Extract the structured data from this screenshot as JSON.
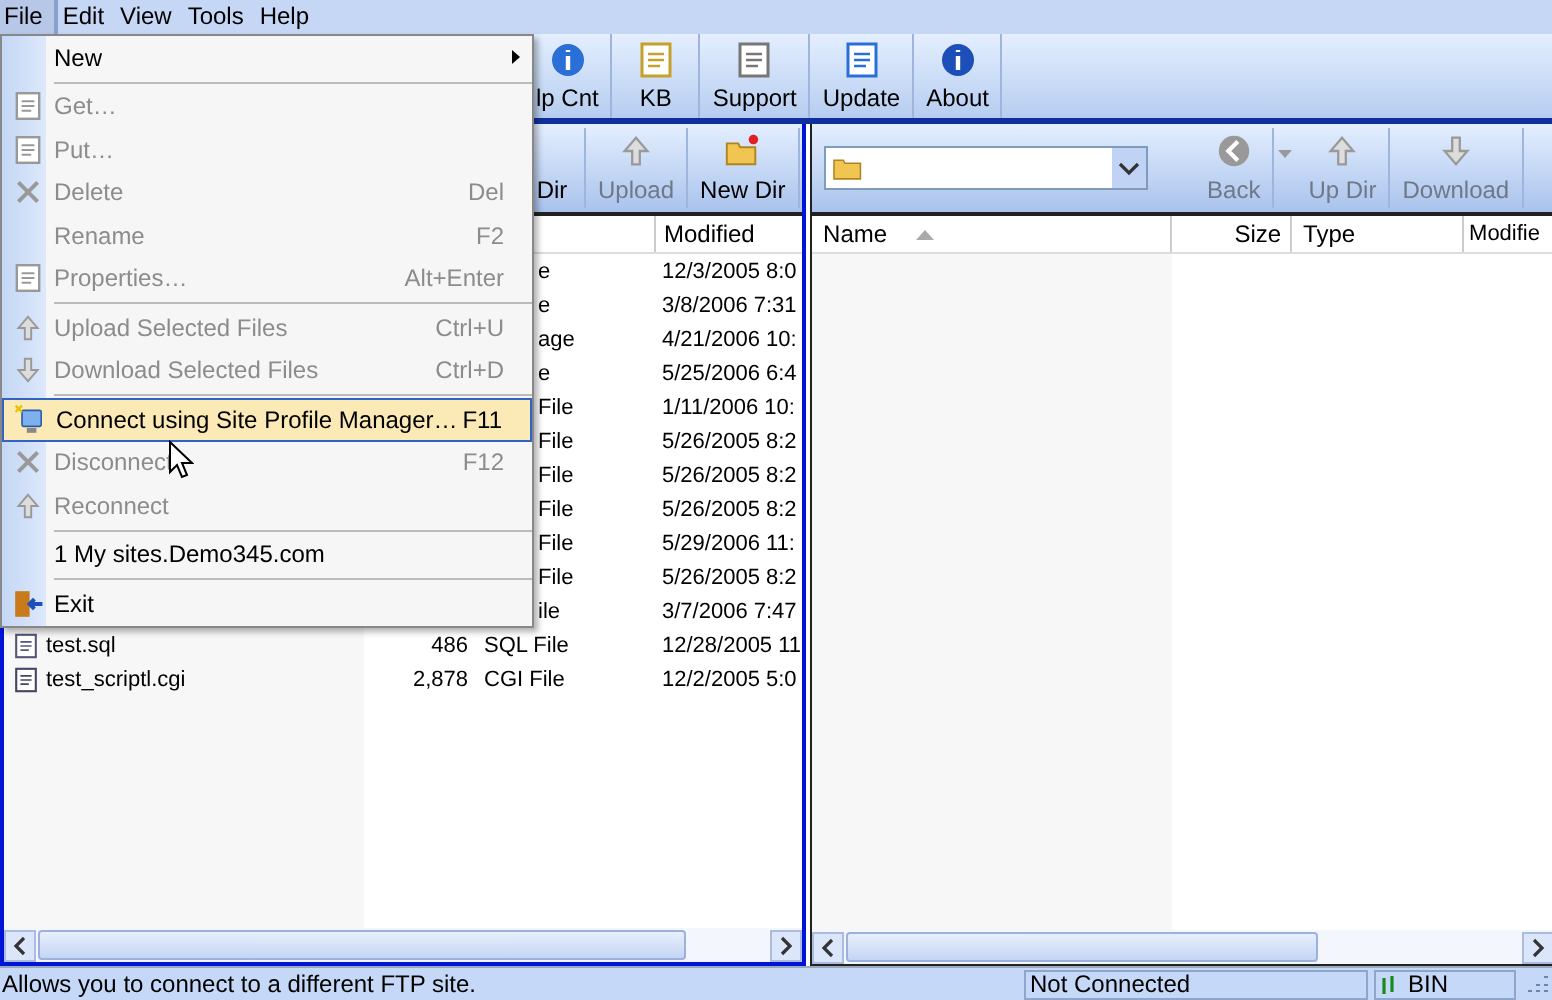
{
  "menu_bar": [
    {
      "label": "File",
      "selected": true
    },
    {
      "label": "Edit",
      "selected": false
    },
    {
      "label": "View",
      "selected": false
    },
    {
      "label": "Tools",
      "selected": false
    },
    {
      "label": "Help",
      "selected": false
    }
  ],
  "toolbar": [
    {
      "label": "lp Cnt"
    },
    {
      "label": "KB"
    },
    {
      "label": "Support"
    },
    {
      "label": "Update"
    },
    {
      "label": "About"
    }
  ],
  "file_menu": [
    {
      "kind": "item",
      "label": "New",
      "submenu": true,
      "disabled": false,
      "selected": false
    },
    {
      "kind": "separator"
    },
    {
      "kind": "item",
      "label": "Get…",
      "submenu": false,
      "disabled": true,
      "selected": false
    },
    {
      "kind": "item",
      "label": "Put…",
      "submenu": false,
      "disabled": true,
      "selected": false
    },
    {
      "kind": "item",
      "label": "Delete",
      "shortcut": "Del",
      "submenu": false,
      "disabled": true,
      "selected": false
    },
    {
      "kind": "item",
      "label": "Rename",
      "shortcut": "F2",
      "submenu": false,
      "disabled": true,
      "selected": false
    },
    {
      "kind": "item",
      "label": "Properties…",
      "shortcut": "Alt+Enter",
      "submenu": false,
      "disabled": true,
      "selected": false
    },
    {
      "kind": "separator"
    },
    {
      "kind": "item",
      "label": "Upload Selected Files",
      "shortcut": "Ctrl+U",
      "submenu": false,
      "disabled": true,
      "selected": false
    },
    {
      "kind": "item",
      "label": "Download Selected Files",
      "shortcut": "Ctrl+D",
      "submenu": false,
      "disabled": true,
      "selected": false
    },
    {
      "kind": "separator"
    },
    {
      "kind": "item",
      "label": "Connect using Site Profile Manager…",
      "shortcut": "F11",
      "submenu": false,
      "disabled": false,
      "selected": true
    },
    {
      "kind": "item",
      "label": "Disconnect",
      "shortcut": "F12",
      "submenu": false,
      "disabled": true,
      "selected": false
    },
    {
      "kind": "item",
      "label": "Reconnect",
      "submenu": false,
      "disabled": true,
      "selected": false
    },
    {
      "kind": "separator"
    },
    {
      "kind": "item",
      "label": "1 My sites.Demo345.com",
      "submenu": false,
      "disabled": false,
      "selected": false
    },
    {
      "kind": "separator"
    },
    {
      "kind": "item",
      "label": "Exit",
      "submenu": false,
      "disabled": false,
      "selected": false
    }
  ],
  "left_pane": {
    "toolbar": [
      {
        "label": "Dir",
        "disabled": false
      },
      {
        "label": "Upload",
        "disabled": true
      },
      {
        "label": "New Dir",
        "disabled": false
      }
    ],
    "column_heading": "Modified",
    "rows": [
      {
        "kind": "covered",
        "type": "e",
        "modified": "12/3/2005 8:0"
      },
      {
        "kind": "covered",
        "type": "e",
        "modified": "3/8/2006 7:31"
      },
      {
        "kind": "covered",
        "type": "age",
        "modified": "4/21/2006 10:"
      },
      {
        "kind": "covered",
        "type": "e",
        "modified": "5/25/2006 6:4"
      },
      {
        "kind": "covered",
        "type": "File",
        "modified": "1/11/2006 10:"
      },
      {
        "kind": "covered",
        "type": "File",
        "modified": "5/26/2005 8:2"
      },
      {
        "kind": "covered",
        "type": "File",
        "modified": "5/26/2005 8:2"
      },
      {
        "kind": "covered",
        "type": "File",
        "modified": "5/26/2005 8:2"
      },
      {
        "kind": "covered",
        "type": "File",
        "modified": "5/29/2006 11:"
      },
      {
        "kind": "covered",
        "type": "File",
        "modified": "5/26/2005 8:2"
      },
      {
        "kind": "covered",
        "type": "ile",
        "modified": "3/7/2006 7:47"
      },
      {
        "kind": "full",
        "name": "test.sql",
        "size": "486",
        "type": "SQL File",
        "modified": "12/28/2005 11"
      },
      {
        "kind": "full",
        "name": "test_scriptl.cgi",
        "size": "2,878",
        "type": "CGI File",
        "modified": "12/2/2005 5:0"
      }
    ]
  },
  "right_pane": {
    "toolbar": [
      {
        "label": "Back",
        "disabled": true
      },
      {
        "label": "Up Dir",
        "disabled": true
      },
      {
        "label": "Download",
        "disabled": true
      }
    ],
    "columns": [
      {
        "label": "Name",
        "sorted": true
      },
      {
        "label": "Size"
      },
      {
        "label": "Type"
      },
      {
        "label": "Modifie"
      }
    ]
  },
  "status_bar": {
    "message": "Allows you to connect to a different FTP site.",
    "connection": "Not Connected",
    "mode": "BIN"
  }
}
